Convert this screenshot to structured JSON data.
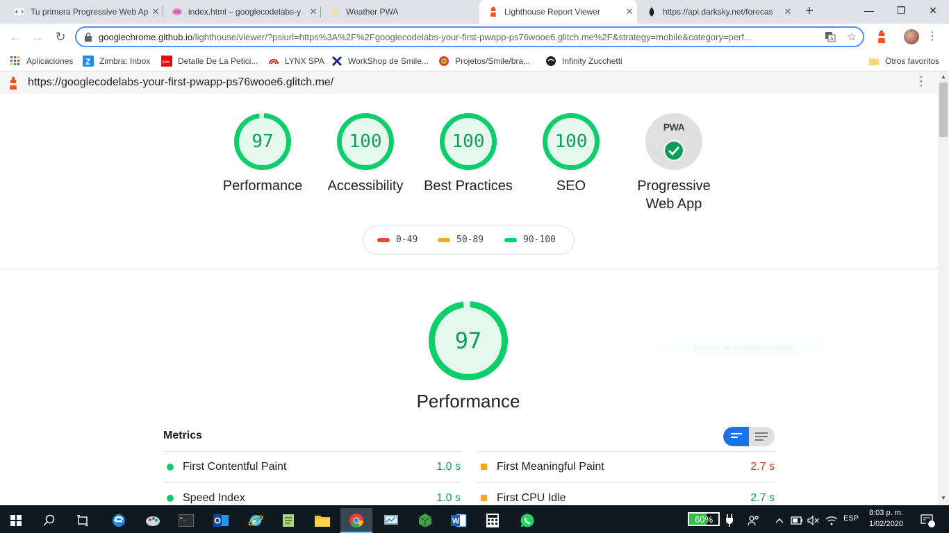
{
  "browser": {
    "tabs": [
      {
        "title": "Tu primera Progressive Web Ap",
        "active": false
      },
      {
        "title": "index.html – googlecodelabs-y",
        "active": false
      },
      {
        "title": "Weather PWA",
        "active": false
      },
      {
        "title": "Lighthouse Report Viewer",
        "active": true
      },
      {
        "title": "https://api.darksky.net/forecas",
        "active": false
      }
    ],
    "new_tab_symbol": "+",
    "url_host": "googlechrome.github.io",
    "url_rest": "/lighthouse/viewer/?psiurl=https%3A%2F%2Fgooglecodelabs-your-first-pwapp-ps76wooe6.glitch.me%2F&strategy=mobile&category=perf...",
    "bookmarks": [
      {
        "label": "Aplicaciones",
        "icon": "apps-grid-icon"
      },
      {
        "label": "Zimbra: Inbox",
        "icon": "zimbra-icon"
      },
      {
        "label": "Detalle De La Petici...",
        "icon": "servicenow-icon"
      },
      {
        "label": "LYNX SPA",
        "icon": "lynx-icon"
      },
      {
        "label": "WorkShop de Smile...",
        "icon": "workshop-icon"
      },
      {
        "label": "Projetos/Smile/bra...",
        "icon": "projetos-icon"
      },
      {
        "label": "Infinity Zucchetti",
        "icon": "infinity-icon"
      }
    ],
    "other_bookmarks": "Otros favoritos"
  },
  "report": {
    "page_url": "https://googlecodelabs-your-first-pwapp-ps76wooe6.glitch.me/",
    "categories": [
      {
        "score": "97",
        "label": "Performance",
        "value": 97
      },
      {
        "score": "100",
        "label": "Accessibility",
        "value": 100
      },
      {
        "score": "100",
        "label": "Best Practices",
        "value": 100
      },
      {
        "score": "100",
        "label": "SEO",
        "value": 100
      }
    ],
    "pwa": {
      "badge": "PWA",
      "label_line1": "Progressive",
      "label_line2": "Web App"
    },
    "legend": [
      {
        "range": "0-49",
        "color": "#eb4335"
      },
      {
        "range": "50-89",
        "color": "#f5a623"
      },
      {
        "range": "90-100",
        "color": "#0cce6b"
      }
    ],
    "performance": {
      "score": "97",
      "value": 97,
      "label": "Performance"
    },
    "ghost_text": "Recorte de pantalla completa",
    "metrics_title": "Metrics",
    "metrics": [
      {
        "name": "First Contentful Paint",
        "value": "1.0 s",
        "status": "pass"
      },
      {
        "name": "First Meaningful Paint",
        "value": "2.7 s",
        "status": "average"
      },
      {
        "name": "Speed Index",
        "value": "1.0 s",
        "status": "pass"
      },
      {
        "name": "First CPU Idle",
        "value": "2.7 s",
        "status": "average"
      }
    ],
    "colors": {
      "pass": "#0cce6b",
      "average": "#f5a623",
      "fail": "#eb4335",
      "pass_text": "#0c9d58",
      "average_text": "#d3361e"
    }
  },
  "taskbar": {
    "apps": [
      "windows-start-icon",
      "search-icon",
      "task-view-icon",
      "edge-icon",
      "paint-icon",
      "terminal-icon",
      "outlook-icon",
      "ie-icon",
      "notepad-icon",
      "file-explorer-icon",
      "chrome-icon",
      "control-panel-icon",
      "cube-app-icon",
      "word-icon",
      "calculator-icon",
      "whatsapp-icon"
    ],
    "battery": "60%",
    "language": "ESP",
    "time": "8:03 p. m.",
    "date": "1/02/2020",
    "notifications": "5"
  }
}
